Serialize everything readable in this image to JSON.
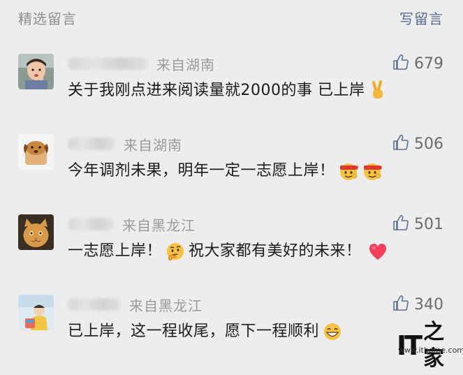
{
  "header": {
    "title": "精选留言",
    "write_label": "写留言"
  },
  "comments": [
    {
      "location": "来自湖南",
      "likes": "679",
      "text": "关于我刚点进来阅读量就2000的事 已上岸",
      "emojis": [
        "victory-hand"
      ]
    },
    {
      "location": "来自湖南",
      "likes": "506",
      "text": "今年调剂未果，明年一定一志愿上岸！",
      "emojis": [
        "headband-face",
        "headband-face"
      ]
    },
    {
      "location": "来自黑龙江",
      "likes": "501",
      "text_before": "一志愿上岸！",
      "text_after": "祝大家都有美好的未来！",
      "emojis": [
        "thinking-face",
        "red-heart"
      ]
    },
    {
      "location": "来自黑龙江",
      "likes": "340",
      "text": "已上岸，这一程收尾，愿下一程顺利",
      "emojis": [
        "grinning-face"
      ]
    }
  ],
  "watermark": {
    "logo_latin": "IT",
    "logo_hanzi": "之家",
    "url": "www.ithome.com"
  },
  "colors": {
    "background": "#ededed",
    "link_blue": "#566b8f",
    "muted": "#9a9a9a",
    "text": "#1a1a1a"
  }
}
